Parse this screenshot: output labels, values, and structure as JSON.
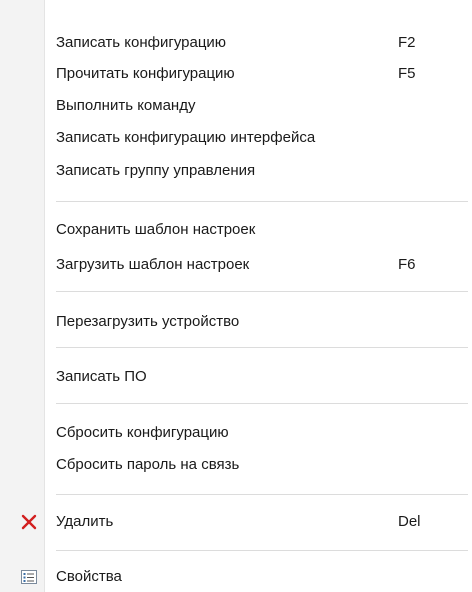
{
  "menu": {
    "items": [
      {
        "label": "Записать конфигурацию",
        "shortcut": "F2"
      },
      {
        "label": "Прочитать конфигурацию",
        "shortcut": "F5"
      },
      {
        "label": "Выполнить команду",
        "shortcut": ""
      },
      {
        "label": "Записать конфигурацию интерфейса",
        "shortcut": ""
      },
      {
        "label": "Записать группу управления",
        "shortcut": ""
      },
      {
        "label": "Сохранить шаблон настроек",
        "shortcut": ""
      },
      {
        "label": "Загрузить шаблон настроек",
        "shortcut": "F6"
      },
      {
        "label": "Перезагрузить устройство",
        "shortcut": ""
      },
      {
        "label": "Записать ПО",
        "shortcut": ""
      },
      {
        "label": "Сбросить конфигурацию",
        "shortcut": ""
      },
      {
        "label": "Сбросить пароль на связь",
        "shortcut": ""
      },
      {
        "label": "Удалить",
        "shortcut": "Del",
        "icon": "delete-x-icon"
      },
      {
        "label": "Свойства",
        "shortcut": "",
        "icon": "properties-list-icon"
      }
    ]
  },
  "colors": {
    "delete_icon": "#d21f1f",
    "properties_icon": "#3a6ea5"
  }
}
